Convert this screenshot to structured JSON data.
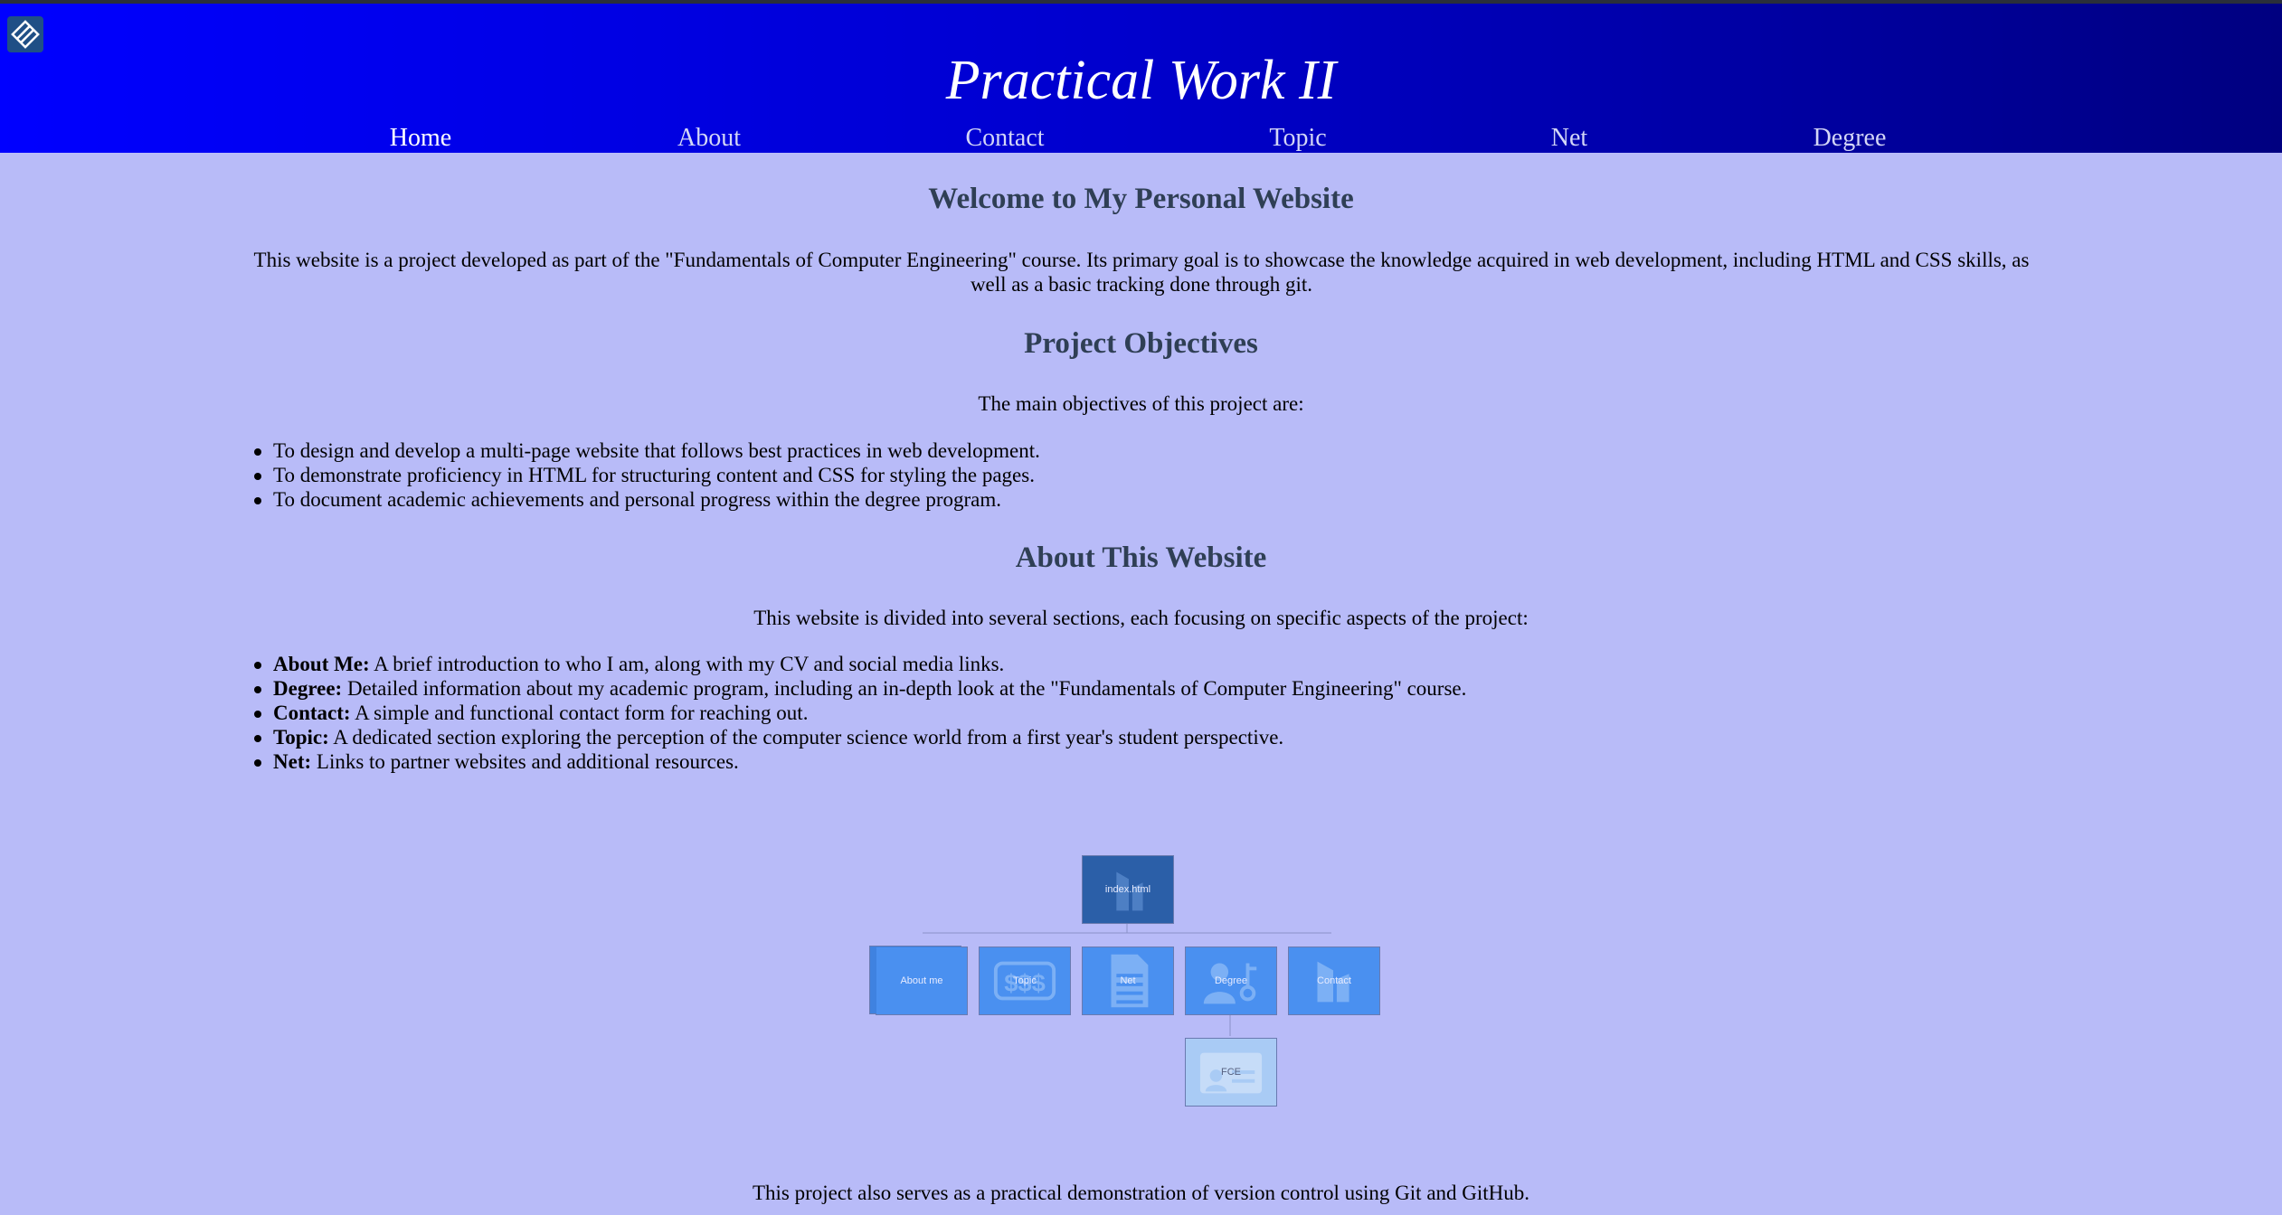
{
  "header": {
    "title": "Practical Work II",
    "nav": [
      {
        "label": "Home",
        "active": true
      },
      {
        "label": "About",
        "active": false
      },
      {
        "label": "Contact",
        "active": false
      },
      {
        "label": "Topic",
        "active": false
      },
      {
        "label": "Net",
        "active": false
      },
      {
        "label": "Degree",
        "active": false
      }
    ]
  },
  "welcome": {
    "heading": "Welcome to My Personal Website",
    "text": "This website is a project developed as part of the \"Fundamentals of Computer Engineering\" course. Its primary goal is to showcase the knowledge acquired in web development, including HTML and CSS skills, as well as a basic tracking done through git."
  },
  "objectives": {
    "heading": "Project Objectives",
    "intro": "The main objectives of this project are:",
    "items": [
      "To design and develop a multi-page website that follows best practices in web development.",
      "To demonstrate proficiency in HTML for structuring content and CSS for styling the pages.",
      "To document academic achievements and personal progress within the degree program."
    ]
  },
  "about": {
    "heading": "About This Website",
    "intro": "This website is divided into several sections, each focusing on specific aspects of the project:",
    "items": [
      {
        "term": "About Me:",
        "text": " A brief introduction to who I am, along with my CV and social media links."
      },
      {
        "term": "Degree:",
        "text": " Detailed information about my academic program, including an in-depth look at the \"Fundamentals of Computer Engineering\" course."
      },
      {
        "term": "Contact:",
        "text": " A simple and functional contact form for reaching out."
      },
      {
        "term": "Topic:",
        "text": " A dedicated section exploring the perception of the computer science world from a first year's student perspective."
      },
      {
        "term": "Net:",
        "text": " Links to partner websites and additional resources."
      }
    ]
  },
  "diagram": {
    "root": "index.html",
    "children": [
      "About me",
      "Topic",
      "Net",
      "Degree",
      "Contact"
    ],
    "sub": "FCE"
  },
  "footer": {
    "text": "This project also serves as a practical demonstration of version control using Git and GitHub."
  },
  "colors": {
    "page_bg": "#b8bbf8",
    "header_gradient_start": "#0000ff",
    "header_gradient_end": "#000080",
    "heading": "#2f3f55",
    "node_blue": "#4a90f0",
    "node_dark": "#1f4f9a",
    "node_light": "#a9cbf5"
  }
}
